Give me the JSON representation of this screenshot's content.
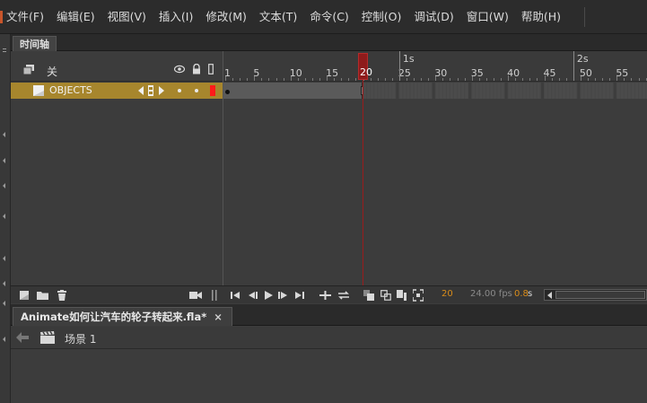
{
  "menu": {
    "items": [
      "文件(F)",
      "编辑(E)",
      "视图(V)",
      "插入(I)",
      "修改(M)",
      "文本(T)",
      "命令(C)",
      "控制(O)",
      "调试(D)",
      "窗口(W)",
      "帮助(H)"
    ]
  },
  "timeline": {
    "tab_label": "时间轴",
    "header_label": "关",
    "ruler_numbers": [
      "1",
      "5",
      "10",
      "15",
      "20",
      "25",
      "30",
      "35",
      "40",
      "45",
      "50",
      "55"
    ],
    "ruler_seconds": [
      "1s",
      "2s"
    ],
    "playhead_frame": "20",
    "layer": {
      "name": "OBJECTS",
      "color": "#ff1a1a"
    },
    "footer": {
      "current_frame": "20",
      "fps": "24.00 fps",
      "elapsed": "0.8",
      "elapsed_unit": "s"
    }
  },
  "document": {
    "tab_label": "Animate如何让汽车的轮子转起来.fla*",
    "close_glyph": "×"
  },
  "editbar": {
    "scene_label": "场景 1"
  },
  "colors": {
    "accent": "#c8552a",
    "layer_row": "#a7862d",
    "playhead": "#9a1c1c",
    "footer_highlight": "#d98c1a"
  }
}
